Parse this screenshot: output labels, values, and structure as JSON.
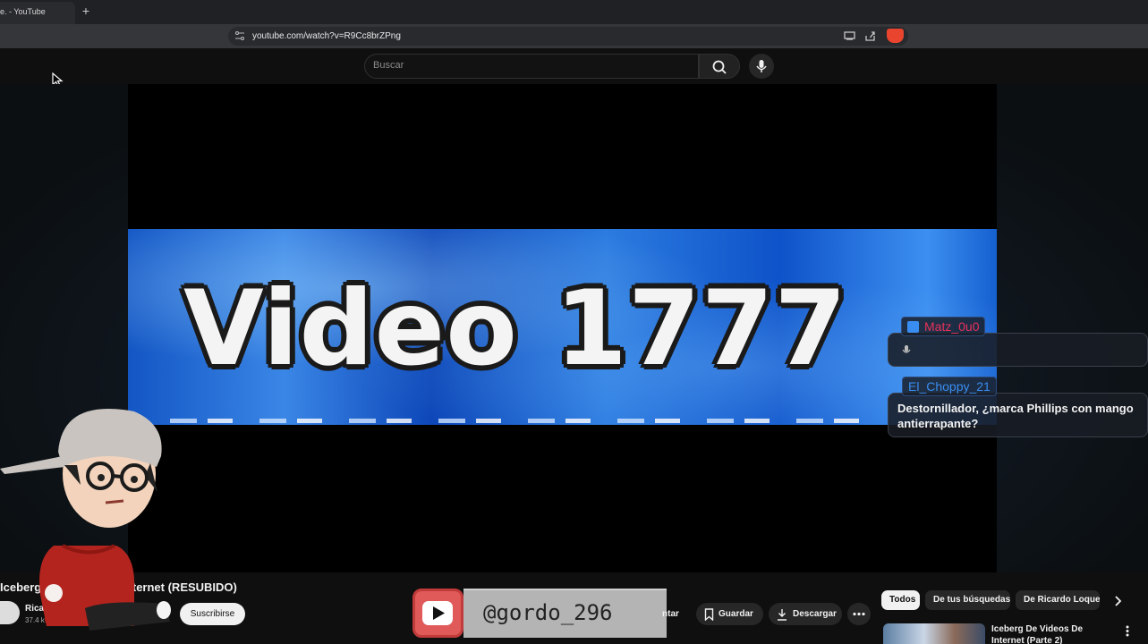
{
  "browser": {
    "tab_title": "e. - YouTube",
    "new_tab_symbol": "+",
    "url": "youtube.com/watch?v=R9Cc8brZPng"
  },
  "youtube": {
    "search_placeholder": "Buscar",
    "player": {
      "banner_text": "Video 1777"
    },
    "video": {
      "title": "Iceberg De Videos De Internet (RESUBIDO)",
      "channel_name": "Ricardo Loquendo",
      "subscribers": "37.4 k suscriptores",
      "subscribe_label": "Suscribirse"
    },
    "actions": {
      "share_partial": "ntar",
      "save_label": "Guardar",
      "download_label": "Descargar"
    },
    "chips": [
      "Todos",
      "De tus búsquedas",
      "De Ricardo Loquendo"
    ],
    "recommendation": {
      "title": "Iceberg De Videos De Internet (Parte 2)"
    }
  },
  "chat": {
    "messages": [
      {
        "user": "Matz_0u0",
        "user_color": "#e8315a",
        "text": ""
      },
      {
        "user": "El_Choppy_21",
        "user_color": "#3a8df0",
        "text": "Destornillador, ¿marca Phillips con mango antierrapante?"
      }
    ]
  },
  "overlay": {
    "handle": "@gordo_296"
  },
  "colors": {
    "youtube_red": "#e05a5a",
    "chat_blue": "#3a8df0",
    "chat_pink": "#e8315a"
  }
}
